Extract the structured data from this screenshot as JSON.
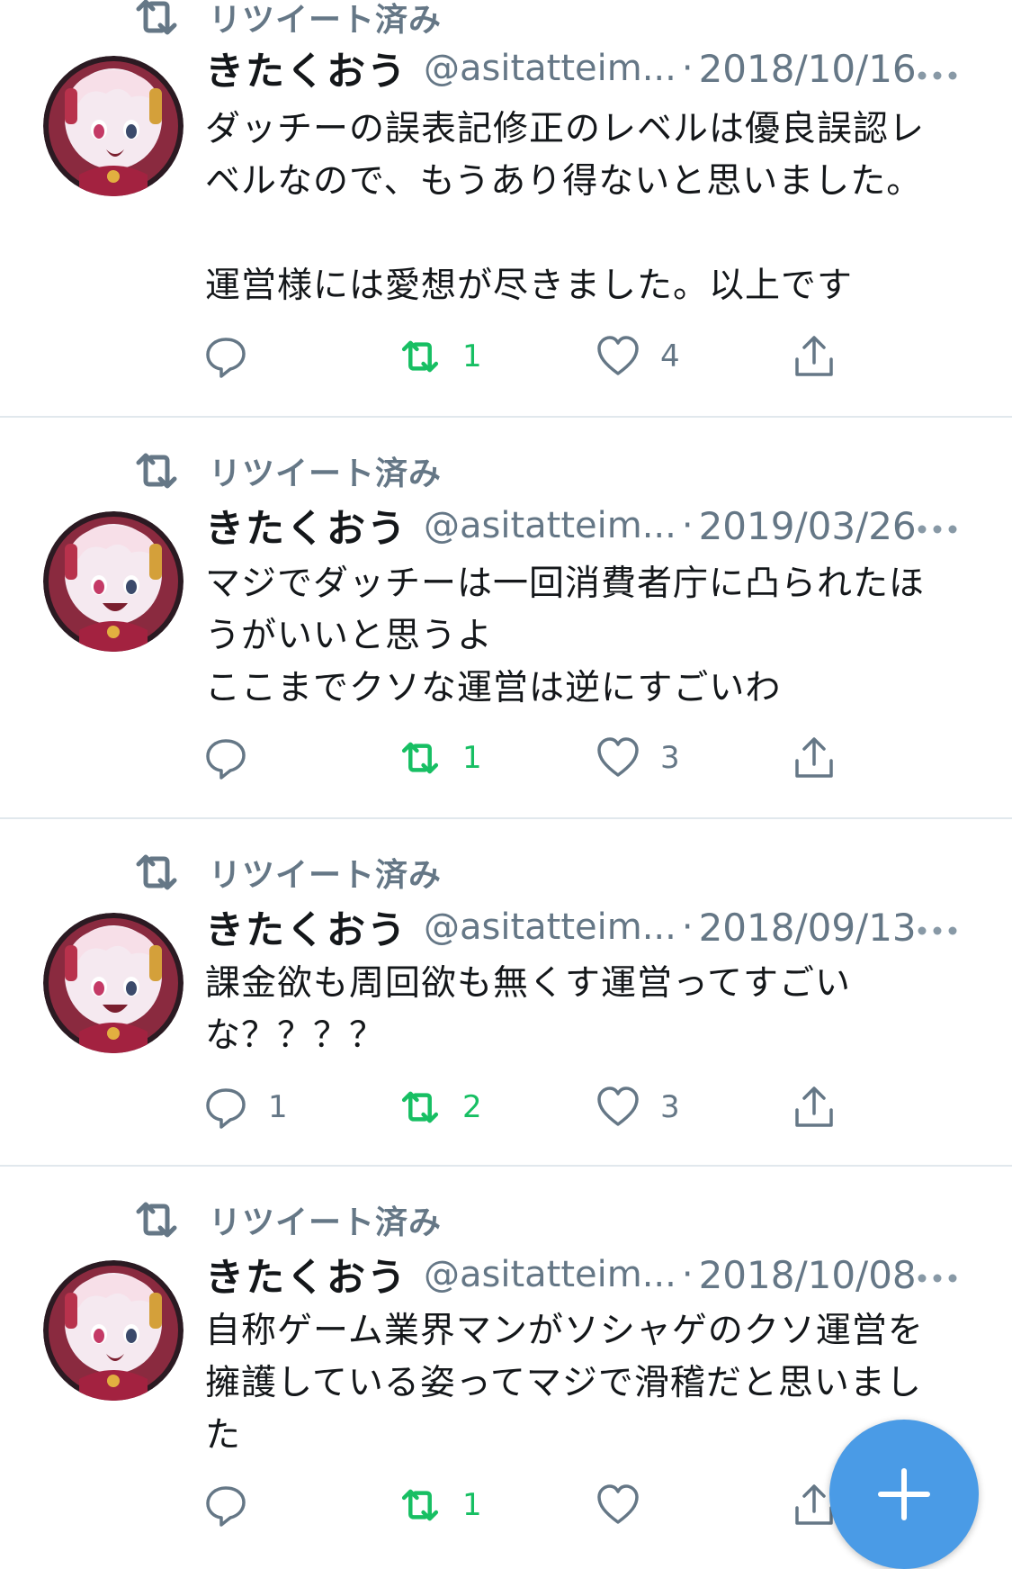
{
  "colors": {
    "retweet_green": "#17bf63",
    "secondary_text": "#657786",
    "fab_blue": "#4a9be6",
    "divider": "#e1e8ed"
  },
  "tweets": [
    {
      "retweet_label": "リツイート済み",
      "name": "きたくおう",
      "handle": "@asitatteim...",
      "separator": "·",
      "date": "2018/10/16",
      "lines": [
        "ダッチーの誤表記修正のレベルは優良誤認レ",
        "ベルなので、もうあり得ないと思いました。",
        "",
        "運営様には愛想が尽きました。以上です"
      ],
      "reply_count": "",
      "retweet_count": "1",
      "like_count": "4"
    },
    {
      "retweet_label": "リツイート済み",
      "name": "きたくおう",
      "handle": "@asitatteim...",
      "separator": "·",
      "date": "2019/03/26",
      "lines": [
        "マジでダッチーは一回消費者庁に凸られたほ",
        "うがいいと思うよ",
        "ここまでクソな運営は逆にすごいわ"
      ],
      "reply_count": "",
      "retweet_count": "1",
      "like_count": "3"
    },
    {
      "retweet_label": "リツイート済み",
      "name": "きたくおう",
      "handle": "@asitatteim...",
      "separator": "·",
      "date": "2018/09/13",
      "lines": [
        "課金欲も周回欲も無くす運営ってすごい",
        "な？？？？"
      ],
      "reply_count": "1",
      "retweet_count": "2",
      "like_count": "3"
    },
    {
      "retweet_label": "リツイート済み",
      "name": "きたくおう",
      "handle": "@asitatteim...",
      "separator": "·",
      "date": "2018/10/08",
      "lines": [
        "自称ゲーム業界マンがソシャゲのクソ運営を",
        "擁護している姿ってマジで滑稽だと思いまし",
        "た"
      ],
      "reply_count": "",
      "retweet_count": "1",
      "like_count": ""
    }
  ],
  "icons": {
    "retweet": "retweet-icon",
    "reply": "reply-icon",
    "like": "heart-icon",
    "share": "share-icon",
    "more": "more-icon",
    "compose": "plus-icon"
  }
}
